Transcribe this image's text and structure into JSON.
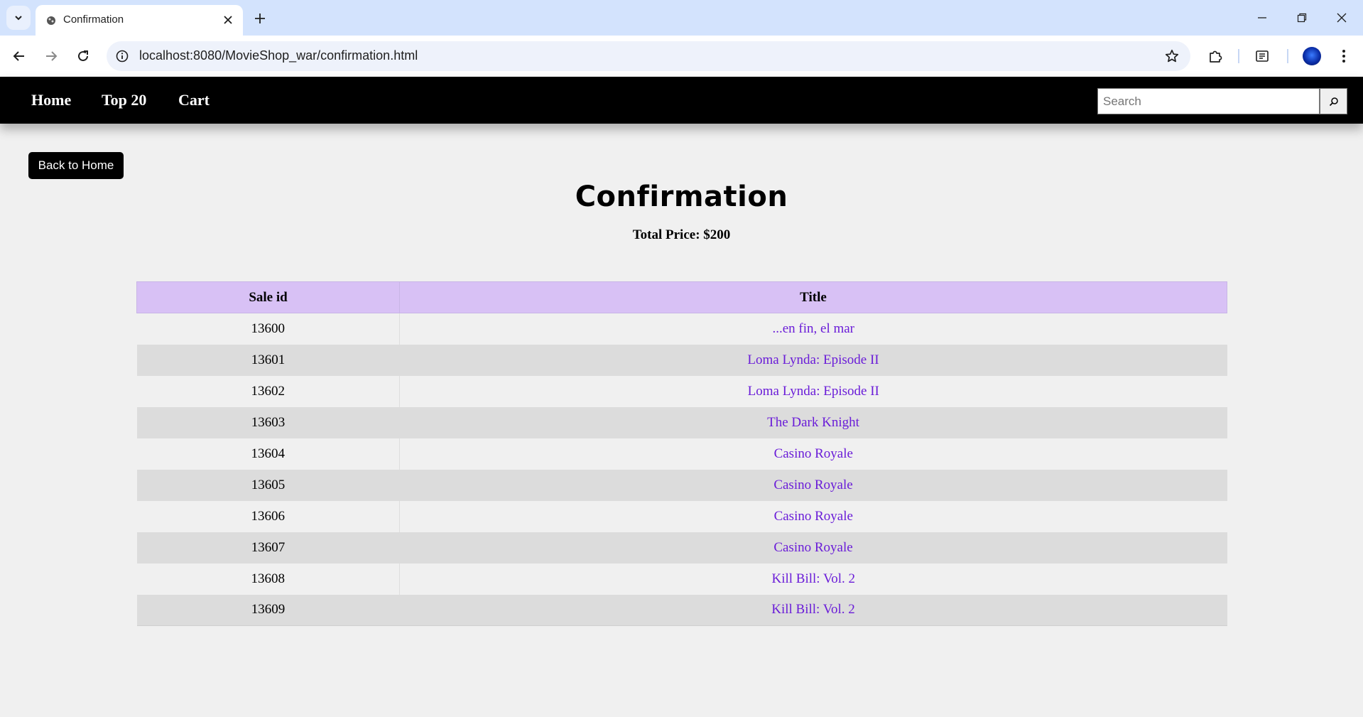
{
  "browser": {
    "tab_title": "Confirmation",
    "url": "localhost:8080/MovieShop_war/confirmation.html"
  },
  "nav": {
    "links": [
      "Home",
      "Top 20",
      "Cart"
    ],
    "search_placeholder": "Search"
  },
  "page": {
    "back_button": "Back to Home",
    "title": "Confirmation",
    "total_price": "Total Price: $200"
  },
  "table": {
    "headers": [
      "Sale id",
      "Title"
    ],
    "rows": [
      {
        "sale_id": "13600",
        "title": "...en fin, el mar"
      },
      {
        "sale_id": "13601",
        "title": "Loma Lynda: Episode II"
      },
      {
        "sale_id": "13602",
        "title": "Loma Lynda: Episode II"
      },
      {
        "sale_id": "13603",
        "title": "The Dark Knight"
      },
      {
        "sale_id": "13604",
        "title": "Casino Royale"
      },
      {
        "sale_id": "13605",
        "title": "Casino Royale"
      },
      {
        "sale_id": "13606",
        "title": "Casino Royale"
      },
      {
        "sale_id": "13607",
        "title": "Casino Royale"
      },
      {
        "sale_id": "13608",
        "title": "Kill Bill: Vol. 2"
      },
      {
        "sale_id": "13609",
        "title": "Kill Bill: Vol. 2"
      }
    ]
  },
  "colors": {
    "nav_bg": "#000000",
    "header_bg": "#d8c1f5",
    "link": "#6a1cd8"
  }
}
